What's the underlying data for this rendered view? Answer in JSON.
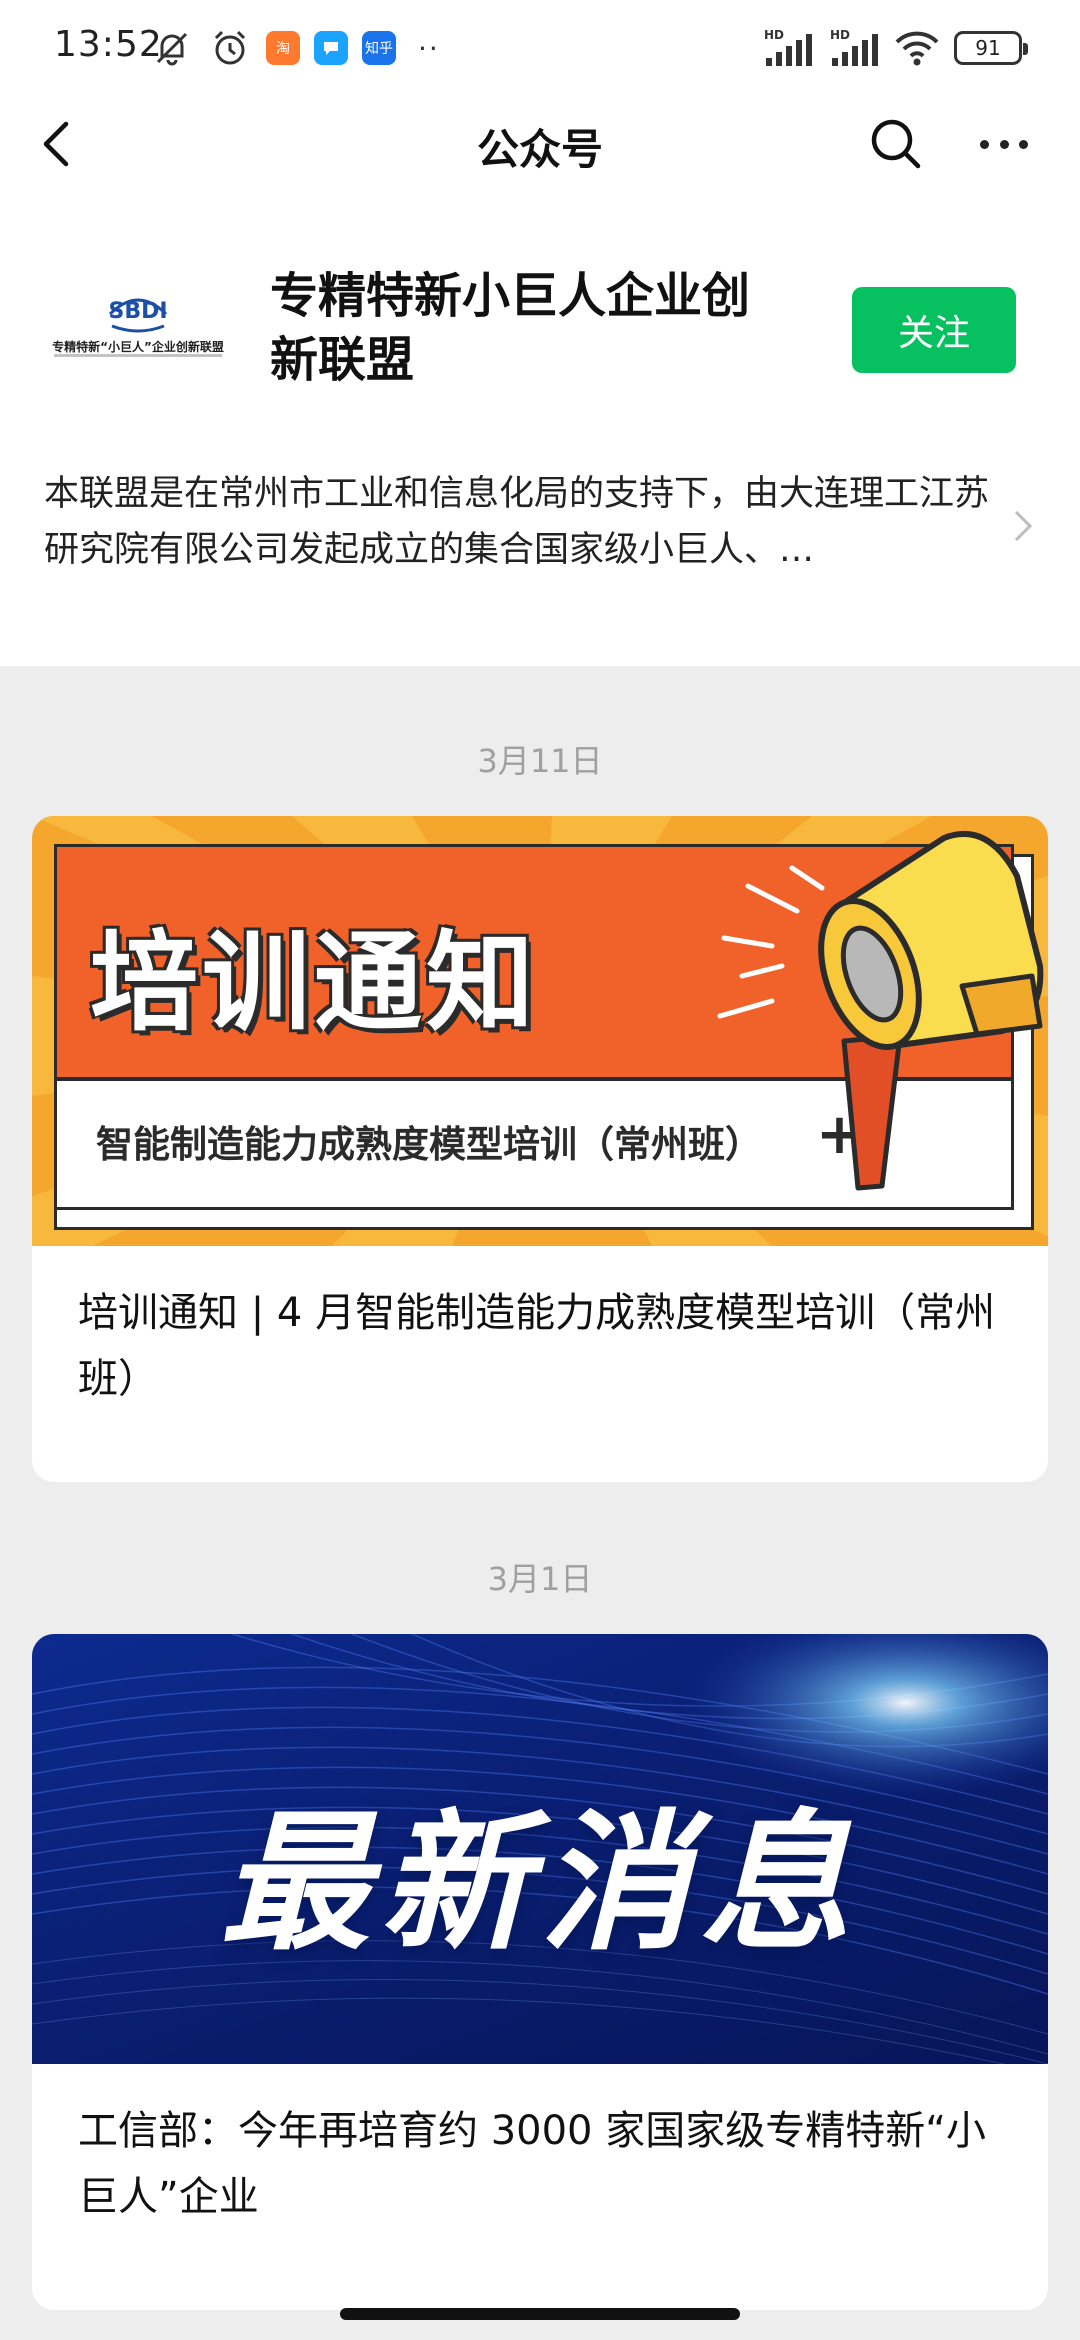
{
  "status_bar": {
    "time": "13:52",
    "app_icons": [
      {
        "name": "taobao-app-icon",
        "label": "淘",
        "color": "#ff7a2f"
      },
      {
        "name": "messenger-app-icon",
        "label": "",
        "color": "#1aa3ff"
      },
      {
        "name": "zhihu-app-icon",
        "label": "知乎",
        "color": "#1a73e8"
      }
    ],
    "more_dots": "··",
    "network_1": "HD",
    "network_2": "HD",
    "battery": "91"
  },
  "nav": {
    "title": "公众号"
  },
  "profile": {
    "logo_text": "专精特新“小巨人”企业创新联盟",
    "name": "专精特新小巨人企业创新联盟",
    "follow_label": "关注",
    "follow_color": "#07c160",
    "intro": "本联盟是在常州市工业和信息化局的支持下，由大连理工江苏研究院有限公司发起成立的集合国家级小巨人、…"
  },
  "feed": [
    {
      "date": "3月11日",
      "cover": {
        "heading": "培训通知",
        "subheading": "智能制造能力成熟度模型培训（常州班）",
        "plus": "+"
      },
      "title": "培训通知 | 4 月智能制造能力成熟度模型培训（常州班）"
    },
    {
      "date": "3月1日",
      "cover": {
        "heading": "最新消息"
      },
      "title": "工信部：今年再培育约 3000 家国家级专精特新“小巨人”企业"
    }
  ]
}
